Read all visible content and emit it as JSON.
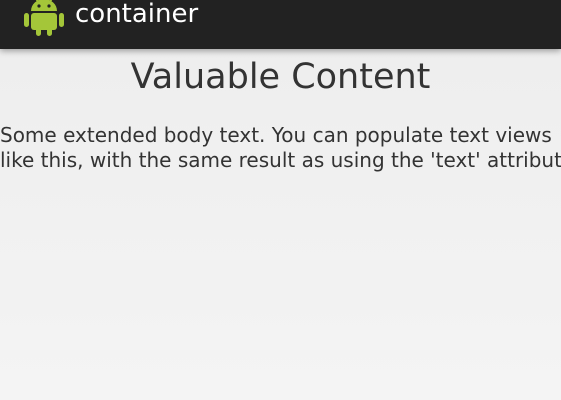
{
  "action_bar": {
    "title": "container",
    "icon": "android-robot-icon",
    "icon_color": "#a4c639"
  },
  "content": {
    "headline": "Valuable Content",
    "body_line_1": "Some extended body text. You can populate text views",
    "body_line_2": "like this, with the same result as using the 'text' attribute."
  }
}
